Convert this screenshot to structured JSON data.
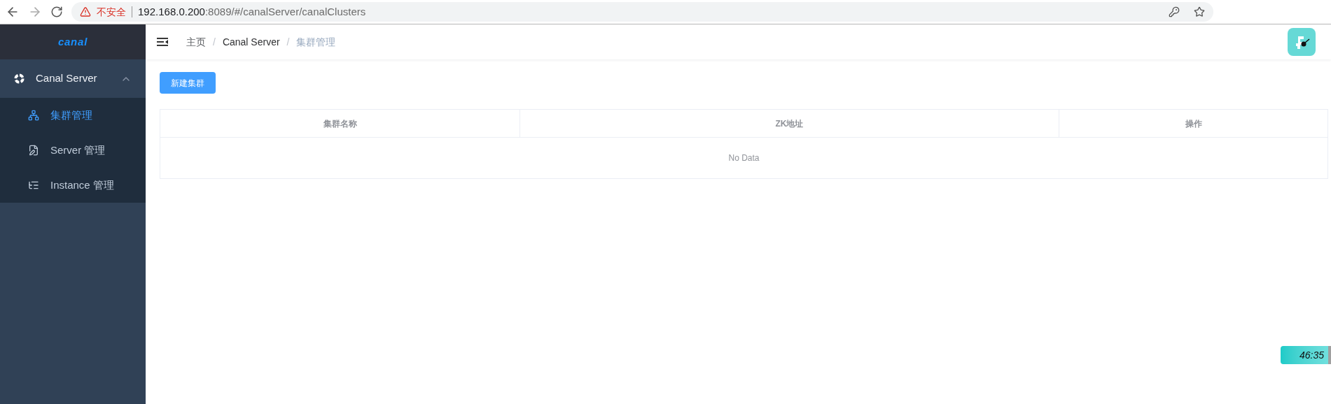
{
  "browser": {
    "security_label": "不安全",
    "url_host": "192.168.0.200",
    "url_rest": ":8089/#/canalServer/canalClusters"
  },
  "sidebar": {
    "logo": "canal",
    "group": {
      "label": "Canal Server",
      "expanded": true
    },
    "items": [
      {
        "label": "集群管理",
        "selected": true,
        "kind": "sitemap"
      },
      {
        "label": "Server 管理",
        "selected": false,
        "kind": "doc"
      },
      {
        "label": "Instance 管理",
        "selected": false,
        "kind": "list"
      }
    ]
  },
  "breadcrumb_separator": "/",
  "breadcrumb": [
    {
      "label": "主页",
      "current": false
    },
    {
      "label": "Canal Server",
      "current": false
    },
    {
      "label": "集群管理",
      "current": true
    }
  ],
  "new_button": "新建集群",
  "table": {
    "columns": [
      "集群名称",
      "ZK地址",
      "操作"
    ],
    "empty_text": "No Data"
  },
  "timer": "46:35"
}
